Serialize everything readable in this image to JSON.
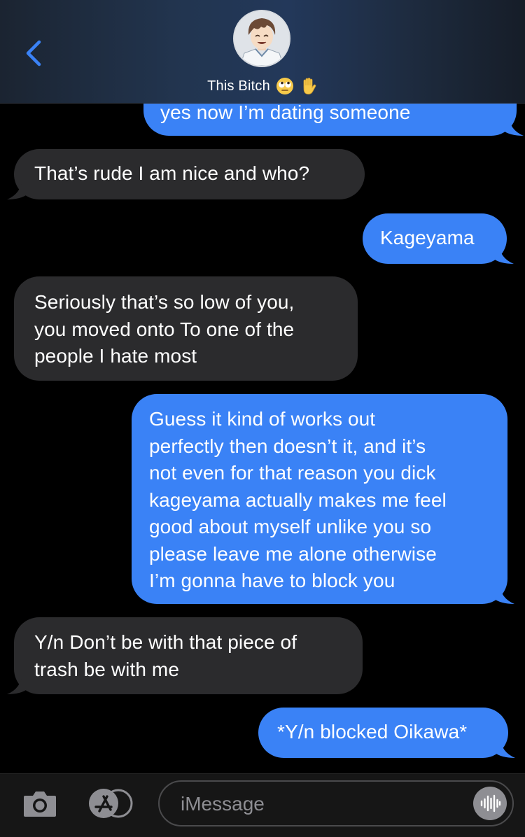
{
  "header": {
    "back_icon": "chevron-left-icon",
    "contact_name": "This Bitch",
    "contact_emojis": [
      "face-with-rolling-eyes",
      "raised-hand"
    ],
    "accent_color": "#3a82f6"
  },
  "messages": [
    {
      "from": "me",
      "text": "yes now I’m dating someone"
    },
    {
      "from": "them",
      "text": "That’s rude I am nice and who?"
    },
    {
      "from": "me",
      "text": "Kageyama"
    },
    {
      "from": "them",
      "lines": [
        "Seriously that’s so low of you,",
        "you moved onto To one of the",
        "people I hate most"
      ]
    },
    {
      "from": "me",
      "lines": [
        "Guess it kind of works out",
        "perfectly then doesn’t it, and it’s",
        "not even for that reason you dick",
        "kageyama actually makes me feel",
        "good about myself unlike you so",
        "please leave me alone otherwise",
        "I’m gonna have to block you"
      ]
    },
    {
      "from": "them",
      "lines": [
        "Y/n Don’t be with that piece of",
        "trash be with me"
      ]
    },
    {
      "from": "me",
      "text": "*Y/n blocked Oikawa*"
    }
  ],
  "colors": {
    "sent_bubble": "#3a82f6",
    "received_bubble": "#2b2b2d",
    "background": "#000000"
  },
  "composer": {
    "camera_icon": "camera-icon",
    "apps_icon": "app-store-icon",
    "placeholder": "iMessage",
    "audio_icon": "audio-waveform-icon"
  }
}
